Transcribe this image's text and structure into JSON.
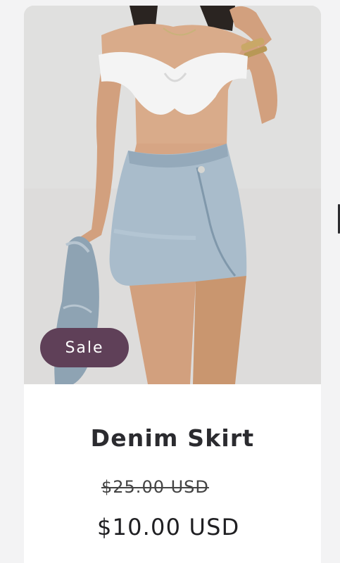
{
  "product": {
    "image_icon": "product-photo",
    "badge": "Sale",
    "title": "Denim Skirt",
    "price_original": "$25.00 USD",
    "price_sale": "$10.00 USD"
  },
  "colors": {
    "badge_bg": "#5f4058",
    "page_bg": "#f3f3f4",
    "card_bg": "#ffffff"
  }
}
